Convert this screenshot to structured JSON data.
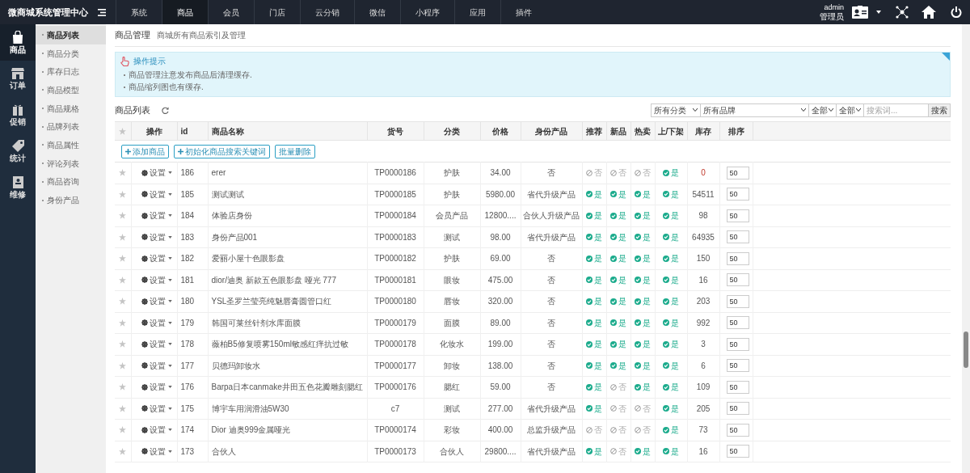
{
  "app_title": "微商城系统管理中心",
  "top_nav": [
    {
      "label": "系统",
      "selected": false
    },
    {
      "label": "商品",
      "selected": true
    },
    {
      "label": "会员",
      "selected": false
    },
    {
      "label": "门店",
      "selected": false
    },
    {
      "label": "云分销",
      "selected": false
    },
    {
      "label": "微信",
      "selected": false
    },
    {
      "label": "小程序",
      "selected": false
    },
    {
      "label": "应用",
      "selected": false
    },
    {
      "label": "插件",
      "selected": false
    }
  ],
  "user": {
    "name": "admin",
    "role": "管理员"
  },
  "sidebar": [
    {
      "label": "商品",
      "selected": true,
      "kind": "bag"
    },
    {
      "label": "订单",
      "selected": false,
      "kind": "store"
    },
    {
      "label": "促销",
      "selected": false,
      "kind": "gift"
    },
    {
      "label": "统计",
      "selected": false,
      "kind": "tag"
    },
    {
      "label": "维修",
      "selected": false,
      "kind": "book"
    }
  ],
  "submenu": [
    {
      "label": "商品列表",
      "selected": true
    },
    {
      "label": "商品分类",
      "selected": false
    },
    {
      "label": "库存日志",
      "selected": false
    },
    {
      "label": "商品模型",
      "selected": false
    },
    {
      "label": "商品规格",
      "selected": false
    },
    {
      "label": "品牌列表",
      "selected": false
    },
    {
      "label": "商品属性",
      "selected": false
    },
    {
      "label": "评论列表",
      "selected": false
    },
    {
      "label": "商品咨询",
      "selected": false
    },
    {
      "label": "身份产品",
      "selected": false
    }
  ],
  "page": {
    "title": "商品管理",
    "subtitle": "商城所有商品索引及管理"
  },
  "tips": {
    "title": "操作提示",
    "items": [
      "商品管理注意发布商品后清理缓存.",
      "商品缩列图也有缓存."
    ]
  },
  "list_title": "商品列表",
  "filters": {
    "category": "所有分类",
    "brand": "所有品牌",
    "filter_3": "全部",
    "filter_4": "全部",
    "search_placeholder": "搜索词...",
    "search_button": "搜索"
  },
  "columns": [
    "操作",
    "id",
    "商品名称",
    "货号",
    "分类",
    "价格",
    "身份产品",
    "推荐",
    "新品",
    "热卖",
    "上/下架",
    "库存",
    "排序"
  ],
  "toolbar": [
    "添加商品",
    "初始化商品搜索关键词",
    "批量删除"
  ],
  "rows": [
    {
      "action": "设置",
      "id": "186",
      "name": "erer",
      "sku": "TP0000186",
      "category": "护肤",
      "price": "34.00",
      "identity": "否",
      "flags": [
        {
          "on": false,
          "label": "否"
        },
        {
          "on": false,
          "label": "否"
        },
        {
          "on": false,
          "label": "否"
        },
        {
          "on": true,
          "label": "是"
        }
      ],
      "stock": "0",
      "stock_low": true,
      "sort": "50"
    },
    {
      "action": "设置",
      "id": "185",
      "name": "测试测试",
      "sku": "TP0000185",
      "category": "护肤",
      "price": "5980.00",
      "identity": "省代升级产品",
      "flags": [
        {
          "on": true,
          "label": "是"
        },
        {
          "on": true,
          "label": "是"
        },
        {
          "on": true,
          "label": "是"
        },
        {
          "on": true,
          "label": "是"
        }
      ],
      "stock": "54511",
      "stock_low": false,
      "sort": "50"
    },
    {
      "action": "设置",
      "id": "184",
      "name": "体验店身份",
      "sku": "TP0000184",
      "category": "会员产品",
      "price": "12800....",
      "identity": "合伙人升级产品",
      "flags": [
        {
          "on": true,
          "label": "是"
        },
        {
          "on": true,
          "label": "是"
        },
        {
          "on": true,
          "label": "是"
        },
        {
          "on": true,
          "label": "是"
        }
      ],
      "stock": "98",
      "stock_low": false,
      "sort": "50"
    },
    {
      "action": "设置",
      "id": "183",
      "name": "身份产品001",
      "sku": "TP0000183",
      "category": "测试",
      "price": "98.00",
      "identity": "省代升级产品",
      "flags": [
        {
          "on": true,
          "label": "是"
        },
        {
          "on": true,
          "label": "是"
        },
        {
          "on": true,
          "label": "是"
        },
        {
          "on": true,
          "label": "是"
        }
      ],
      "stock": "64935",
      "stock_low": false,
      "sort": "50"
    },
    {
      "action": "设置",
      "id": "182",
      "name": "爱丽小屋十色眼影盘",
      "sku": "TP0000182",
      "category": "护肤",
      "price": "69.00",
      "identity": "否",
      "flags": [
        {
          "on": true,
          "label": "是"
        },
        {
          "on": true,
          "label": "是"
        },
        {
          "on": true,
          "label": "是"
        },
        {
          "on": true,
          "label": "是"
        }
      ],
      "stock": "150",
      "stock_low": false,
      "sort": "50"
    },
    {
      "action": "设置",
      "id": "181",
      "name": "dior/迪奥 新款五色眼影盘 哑光 777",
      "sku": "TP0000181",
      "category": "眼妆",
      "price": "475.00",
      "identity": "否",
      "flags": [
        {
          "on": true,
          "label": "是"
        },
        {
          "on": true,
          "label": "是"
        },
        {
          "on": true,
          "label": "是"
        },
        {
          "on": true,
          "label": "是"
        }
      ],
      "stock": "16",
      "stock_low": false,
      "sort": "50"
    },
    {
      "action": "设置",
      "id": "180",
      "name": "YSL圣罗兰莹亮纯魅唇膏圆管口红",
      "sku": "TP0000180",
      "category": "唇妆",
      "price": "320.00",
      "identity": "否",
      "flags": [
        {
          "on": true,
          "label": "是"
        },
        {
          "on": true,
          "label": "是"
        },
        {
          "on": true,
          "label": "是"
        },
        {
          "on": true,
          "label": "是"
        }
      ],
      "stock": "203",
      "stock_low": false,
      "sort": "50"
    },
    {
      "action": "设置",
      "id": "179",
      "name": "韩国可莱丝针剂水库面膜",
      "sku": "TP0000179",
      "category": "面膜",
      "price": "89.00",
      "identity": "否",
      "flags": [
        {
          "on": true,
          "label": "是"
        },
        {
          "on": true,
          "label": "是"
        },
        {
          "on": true,
          "label": "是"
        },
        {
          "on": true,
          "label": "是"
        }
      ],
      "stock": "992",
      "stock_low": false,
      "sort": "50"
    },
    {
      "action": "设置",
      "id": "178",
      "name": "薇柏B5修复喷雾150ml敏感红痒抗过敏",
      "sku": "TP0000178",
      "category": "化妆水",
      "price": "199.00",
      "identity": "否",
      "flags": [
        {
          "on": true,
          "label": "是"
        },
        {
          "on": true,
          "label": "是"
        },
        {
          "on": true,
          "label": "是"
        },
        {
          "on": true,
          "label": "是"
        }
      ],
      "stock": "3",
      "stock_low": false,
      "sort": "50"
    },
    {
      "action": "设置",
      "id": "177",
      "name": "贝德玛卸妆水",
      "sku": "TP0000177",
      "category": "卸妆",
      "price": "138.00",
      "identity": "否",
      "flags": [
        {
          "on": true,
          "label": "是"
        },
        {
          "on": true,
          "label": "是"
        },
        {
          "on": true,
          "label": "是"
        },
        {
          "on": true,
          "label": "是"
        }
      ],
      "stock": "6",
      "stock_low": false,
      "sort": "50"
    },
    {
      "action": "设置",
      "id": "176",
      "name": "Barpa日本canmake井田五色花瓣雕刻腮红",
      "sku": "TP0000176",
      "category": "腮红",
      "price": "59.00",
      "identity": "否",
      "flags": [
        {
          "on": true,
          "label": "是"
        },
        {
          "on": false,
          "label": "否"
        },
        {
          "on": true,
          "label": "是"
        },
        {
          "on": true,
          "label": "是"
        }
      ],
      "stock": "109",
      "stock_low": false,
      "sort": "50"
    },
    {
      "action": "设置",
      "id": "175",
      "name": "博宇车用润滑油5W30",
      "sku": "c7",
      "category": "测试",
      "price": "277.00",
      "identity": "省代升级产品",
      "flags": [
        {
          "on": true,
          "label": "是"
        },
        {
          "on": false,
          "label": "否"
        },
        {
          "on": false,
          "label": "否"
        },
        {
          "on": true,
          "label": "是"
        }
      ],
      "stock": "205",
      "stock_low": false,
      "sort": "50"
    },
    {
      "action": "设置",
      "id": "174",
      "name": "Dior 迪奥999金属哑光",
      "sku": "TP0000174",
      "category": "彩妆",
      "price": "400.00",
      "identity": "总监升级产品",
      "flags": [
        {
          "on": false,
          "label": "否"
        },
        {
          "on": false,
          "label": "否"
        },
        {
          "on": false,
          "label": "否"
        },
        {
          "on": true,
          "label": "是"
        }
      ],
      "stock": "73",
      "stock_low": false,
      "sort": "50"
    },
    {
      "action": "设置",
      "id": "173",
      "name": "合伙人",
      "sku": "TP0000173",
      "category": "合伙人",
      "price": "29800....",
      "identity": "省代升级产品",
      "flags": [
        {
          "on": true,
          "label": "是"
        },
        {
          "on": false,
          "label": "否"
        },
        {
          "on": true,
          "label": "是"
        },
        {
          "on": true,
          "label": "是"
        }
      ],
      "stock": "16",
      "stock_low": false,
      "sort": "50"
    }
  ]
}
